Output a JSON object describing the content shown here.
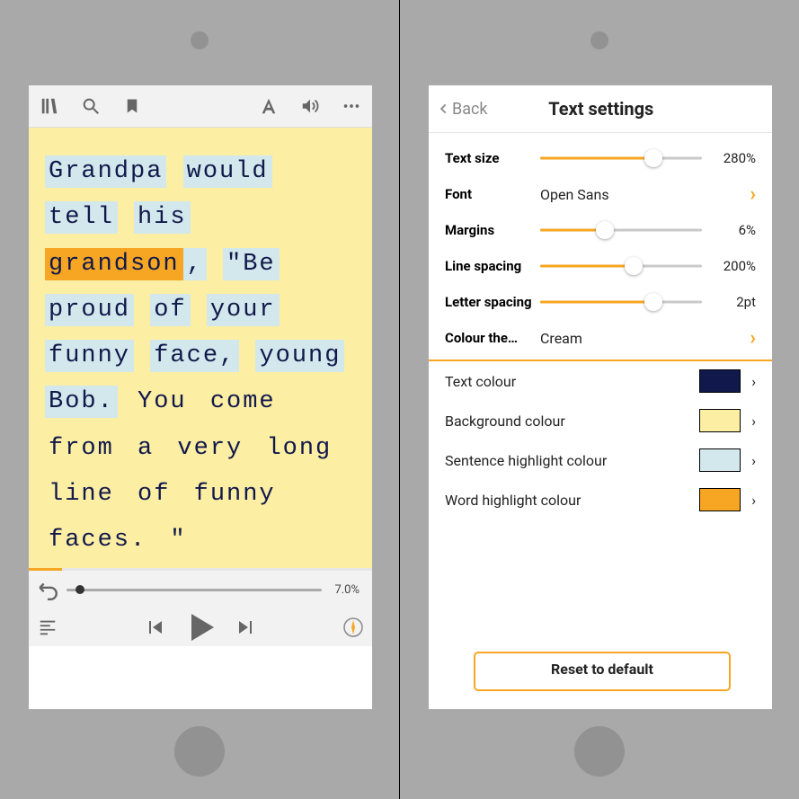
{
  "left": {
    "toolbar": {
      "icons": [
        "library",
        "search",
        "bookmark",
        "font",
        "volume",
        "more"
      ]
    },
    "reader": {
      "words": [
        {
          "t": "Grandpa",
          "sent": true
        },
        {
          "t": "would",
          "sent": true
        },
        {
          "t": "tell",
          "sent": true
        },
        {
          "t": "his",
          "sent": true
        },
        {
          "t": "grandson",
          "sent": true,
          "word": true
        },
        {
          "t": ",",
          "sent": true,
          "nosp": true
        },
        {
          "t": "\"Be",
          "sent": true
        },
        {
          "t": "proud",
          "sent": true
        },
        {
          "t": "of",
          "sent": true
        },
        {
          "t": "your",
          "sent": true
        },
        {
          "t": "funny",
          "sent": true
        },
        {
          "t": "face,",
          "sent": true
        },
        {
          "t": "young",
          "sent": true
        },
        {
          "t": "Bob.",
          "sent": true
        },
        {
          "t": "You"
        },
        {
          "t": "come"
        },
        {
          "t": "from"
        },
        {
          "t": "a"
        },
        {
          "t": "very"
        },
        {
          "t": "long"
        },
        {
          "t": "line"
        },
        {
          "t": "of"
        },
        {
          "t": "funny"
        },
        {
          "t": "faces."
        },
        {
          "t": "\""
        }
      ]
    },
    "progress_pct": 7.0,
    "progress_label": "7.0%"
  },
  "right": {
    "back": "Back",
    "title": "Text settings",
    "sliders": [
      {
        "label": "Text size",
        "value": "280%",
        "pct": 70
      },
      {
        "label": "Margins",
        "value": "6%",
        "pct": 40
      },
      {
        "label": "Line spacing",
        "value": "200%",
        "pct": 58
      },
      {
        "label": "Letter spacing",
        "value": "2pt",
        "pct": 70
      }
    ],
    "font_label": "Font",
    "font_value": "Open Sans",
    "theme_label": "Colour the…",
    "theme_value": "Cream",
    "colours": [
      {
        "label": "Text colour",
        "hex": "#11184b"
      },
      {
        "label": "Background colour",
        "hex": "#fceea3"
      },
      {
        "label": "Sentence highlight colour",
        "hex": "#d3e8ec"
      },
      {
        "label": "Word highlight colour",
        "hex": "#f6a623"
      }
    ],
    "reset": "Reset to default"
  }
}
